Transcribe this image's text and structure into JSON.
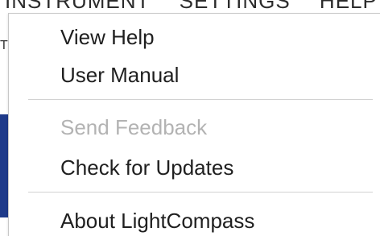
{
  "menubar": {
    "items": [
      "INSTRUMENT",
      "SETTINGS",
      "HELP"
    ]
  },
  "help_menu": {
    "items": [
      {
        "label": "View Help",
        "enabled": true
      },
      {
        "label": "User Manual",
        "enabled": true
      },
      {
        "label": "Send Feedback",
        "enabled": false
      },
      {
        "label": "Check for Updates",
        "enabled": true
      },
      {
        "label": "About LightCompass",
        "enabled": true
      }
    ]
  },
  "colors": {
    "text": "#1f1f1f",
    "disabled_text": "#b3b3b3",
    "separator": "#d2d2d2",
    "accent_bar": "#1e3a8a"
  }
}
